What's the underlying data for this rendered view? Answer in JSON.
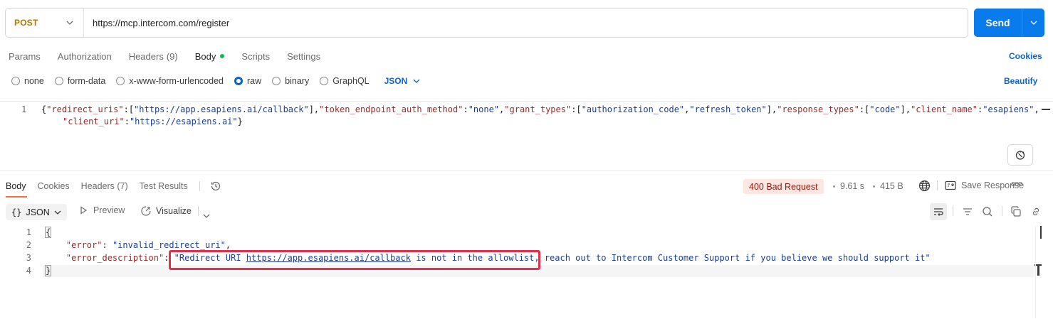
{
  "request": {
    "method": "POST",
    "url": "https://mcp.intercom.com/register",
    "send_label": "Send"
  },
  "request_tabs": [
    {
      "label": "Params"
    },
    {
      "label": "Authorization"
    },
    {
      "label": "Headers",
      "count": "(9)"
    },
    {
      "label": "Body",
      "active": true
    },
    {
      "label": "Scripts"
    },
    {
      "label": "Settings"
    }
  ],
  "cookies_link": "Cookies",
  "body_types": [
    {
      "label": "none"
    },
    {
      "label": "form-data"
    },
    {
      "label": "x-www-form-urlencoded"
    },
    {
      "label": "raw",
      "selected": true
    },
    {
      "label": "binary"
    },
    {
      "label": "GraphQL"
    }
  ],
  "raw_language": "JSON",
  "beautify_link": "Beautify",
  "request_editor": {
    "line_number": "1",
    "line1": {
      "p1": "{",
      "k1": "\"redirect_uris\"",
      "p2": ":[",
      "s1": "\"https://app.esapiens.ai/callback\"",
      "p3": "],",
      "k2": "\"token_endpoint_auth_method\"",
      "p4": ":",
      "s2": "\"none\"",
      "p5": ",",
      "k3": "\"grant_types\"",
      "p6": ":[",
      "s3": "\"authorization_code\"",
      "p7": ",",
      "s4": "\"refresh_token\"",
      "p8": "],",
      "k4": "\"response_types\"",
      "p9": ":[",
      "s5": "\"code\"",
      "p10": "],",
      "k5": "\"client_name\"",
      "p11": ":",
      "s6": "\"esapiens\"",
      "p12": ","
    },
    "line1_wrap": {
      "k6": "\"client_uri\"",
      "p13": ":",
      "s7": "\"https://esapiens.ai\"",
      "p14": "}"
    }
  },
  "response_tabs": [
    {
      "label": "Body",
      "active": true
    },
    {
      "label": "Cookies"
    },
    {
      "label": "Headers (7)"
    },
    {
      "label": "Test Results"
    }
  ],
  "response_meta": {
    "status": "400 Bad Request",
    "time": "9.61 s",
    "size": "415 B",
    "save_label": "Save Response",
    "more": "ooo"
  },
  "response_toolbar": {
    "format": "JSON",
    "preview": "Preview",
    "visualize": "Visualize"
  },
  "response_body": {
    "line_numbers": [
      "1",
      "2",
      "3",
      "4"
    ],
    "open_brace": "{",
    "close_brace": "}",
    "error_key": "\"error\"",
    "error_value": "\"invalid_redirect_uri\"",
    "desc_key": "\"error_description\"",
    "desc_pre": "\"Redirect URI ",
    "desc_link": "https://app.esapiens.ai/callback",
    "desc_post": " is not in the allowlist, reach out to Intercom Customer Support if you believe we should support it\""
  },
  "colors": {
    "method": "#ad7a03",
    "send": "#097bed",
    "accent_link": "#0b64c9",
    "json_key": "#962a2a",
    "json_string": "#1b3e92",
    "error_badge_bg": "#fde7e2",
    "annotation_box": "#e0304b"
  }
}
